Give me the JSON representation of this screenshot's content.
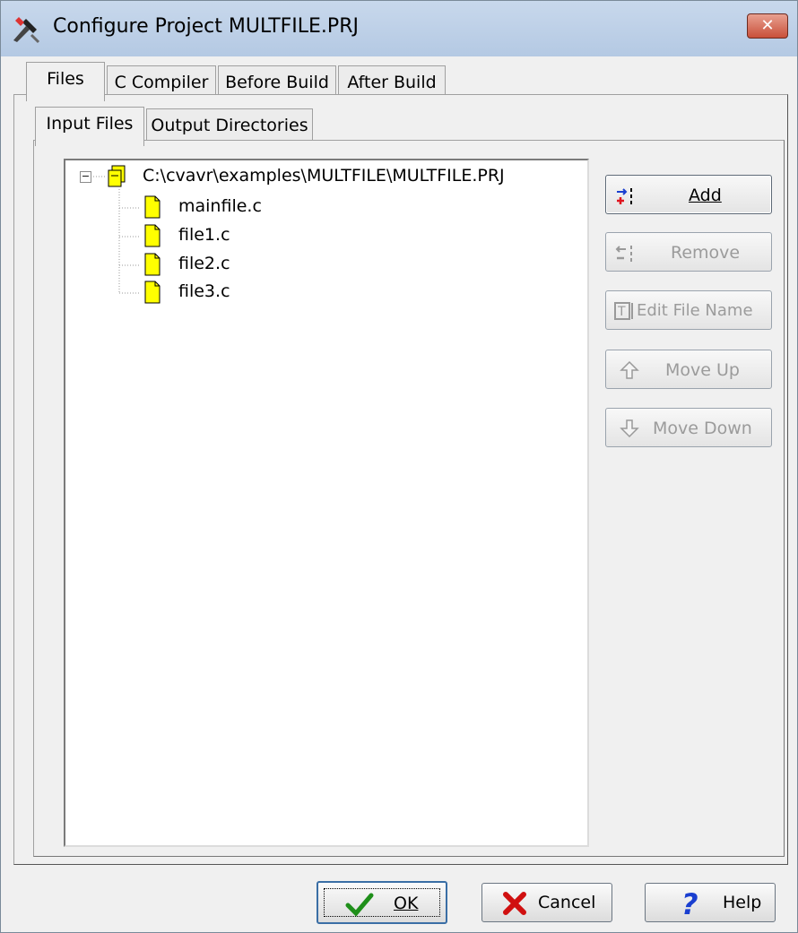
{
  "window": {
    "title": "Configure Project MULTFILE.PRJ",
    "close_glyph": "✕"
  },
  "tabs": [
    {
      "label": "Files"
    },
    {
      "label": "C Compiler"
    },
    {
      "label": "Before Build"
    },
    {
      "label": "After Build"
    }
  ],
  "subtabs": [
    {
      "label": "Input Files"
    },
    {
      "label": "Output Directories"
    }
  ],
  "tree": {
    "root_toggle": "−",
    "root": "C:\\cvavr\\examples\\MULTFILE\\MULTFILE.PRJ",
    "files": [
      "mainfile.c",
      "file1.c",
      "file2.c",
      "file3.c"
    ]
  },
  "side_buttons": {
    "add": "Add",
    "remove": "Remove",
    "edit_file_name": "Edit File Name",
    "move_up": "Move Up",
    "move_down": "Move Down"
  },
  "bottom_buttons": {
    "ok": "OK",
    "cancel": "Cancel",
    "help": "Help"
  },
  "colors": {
    "file_icon": "#ffff00",
    "titlebar": "#b4c9e3"
  }
}
